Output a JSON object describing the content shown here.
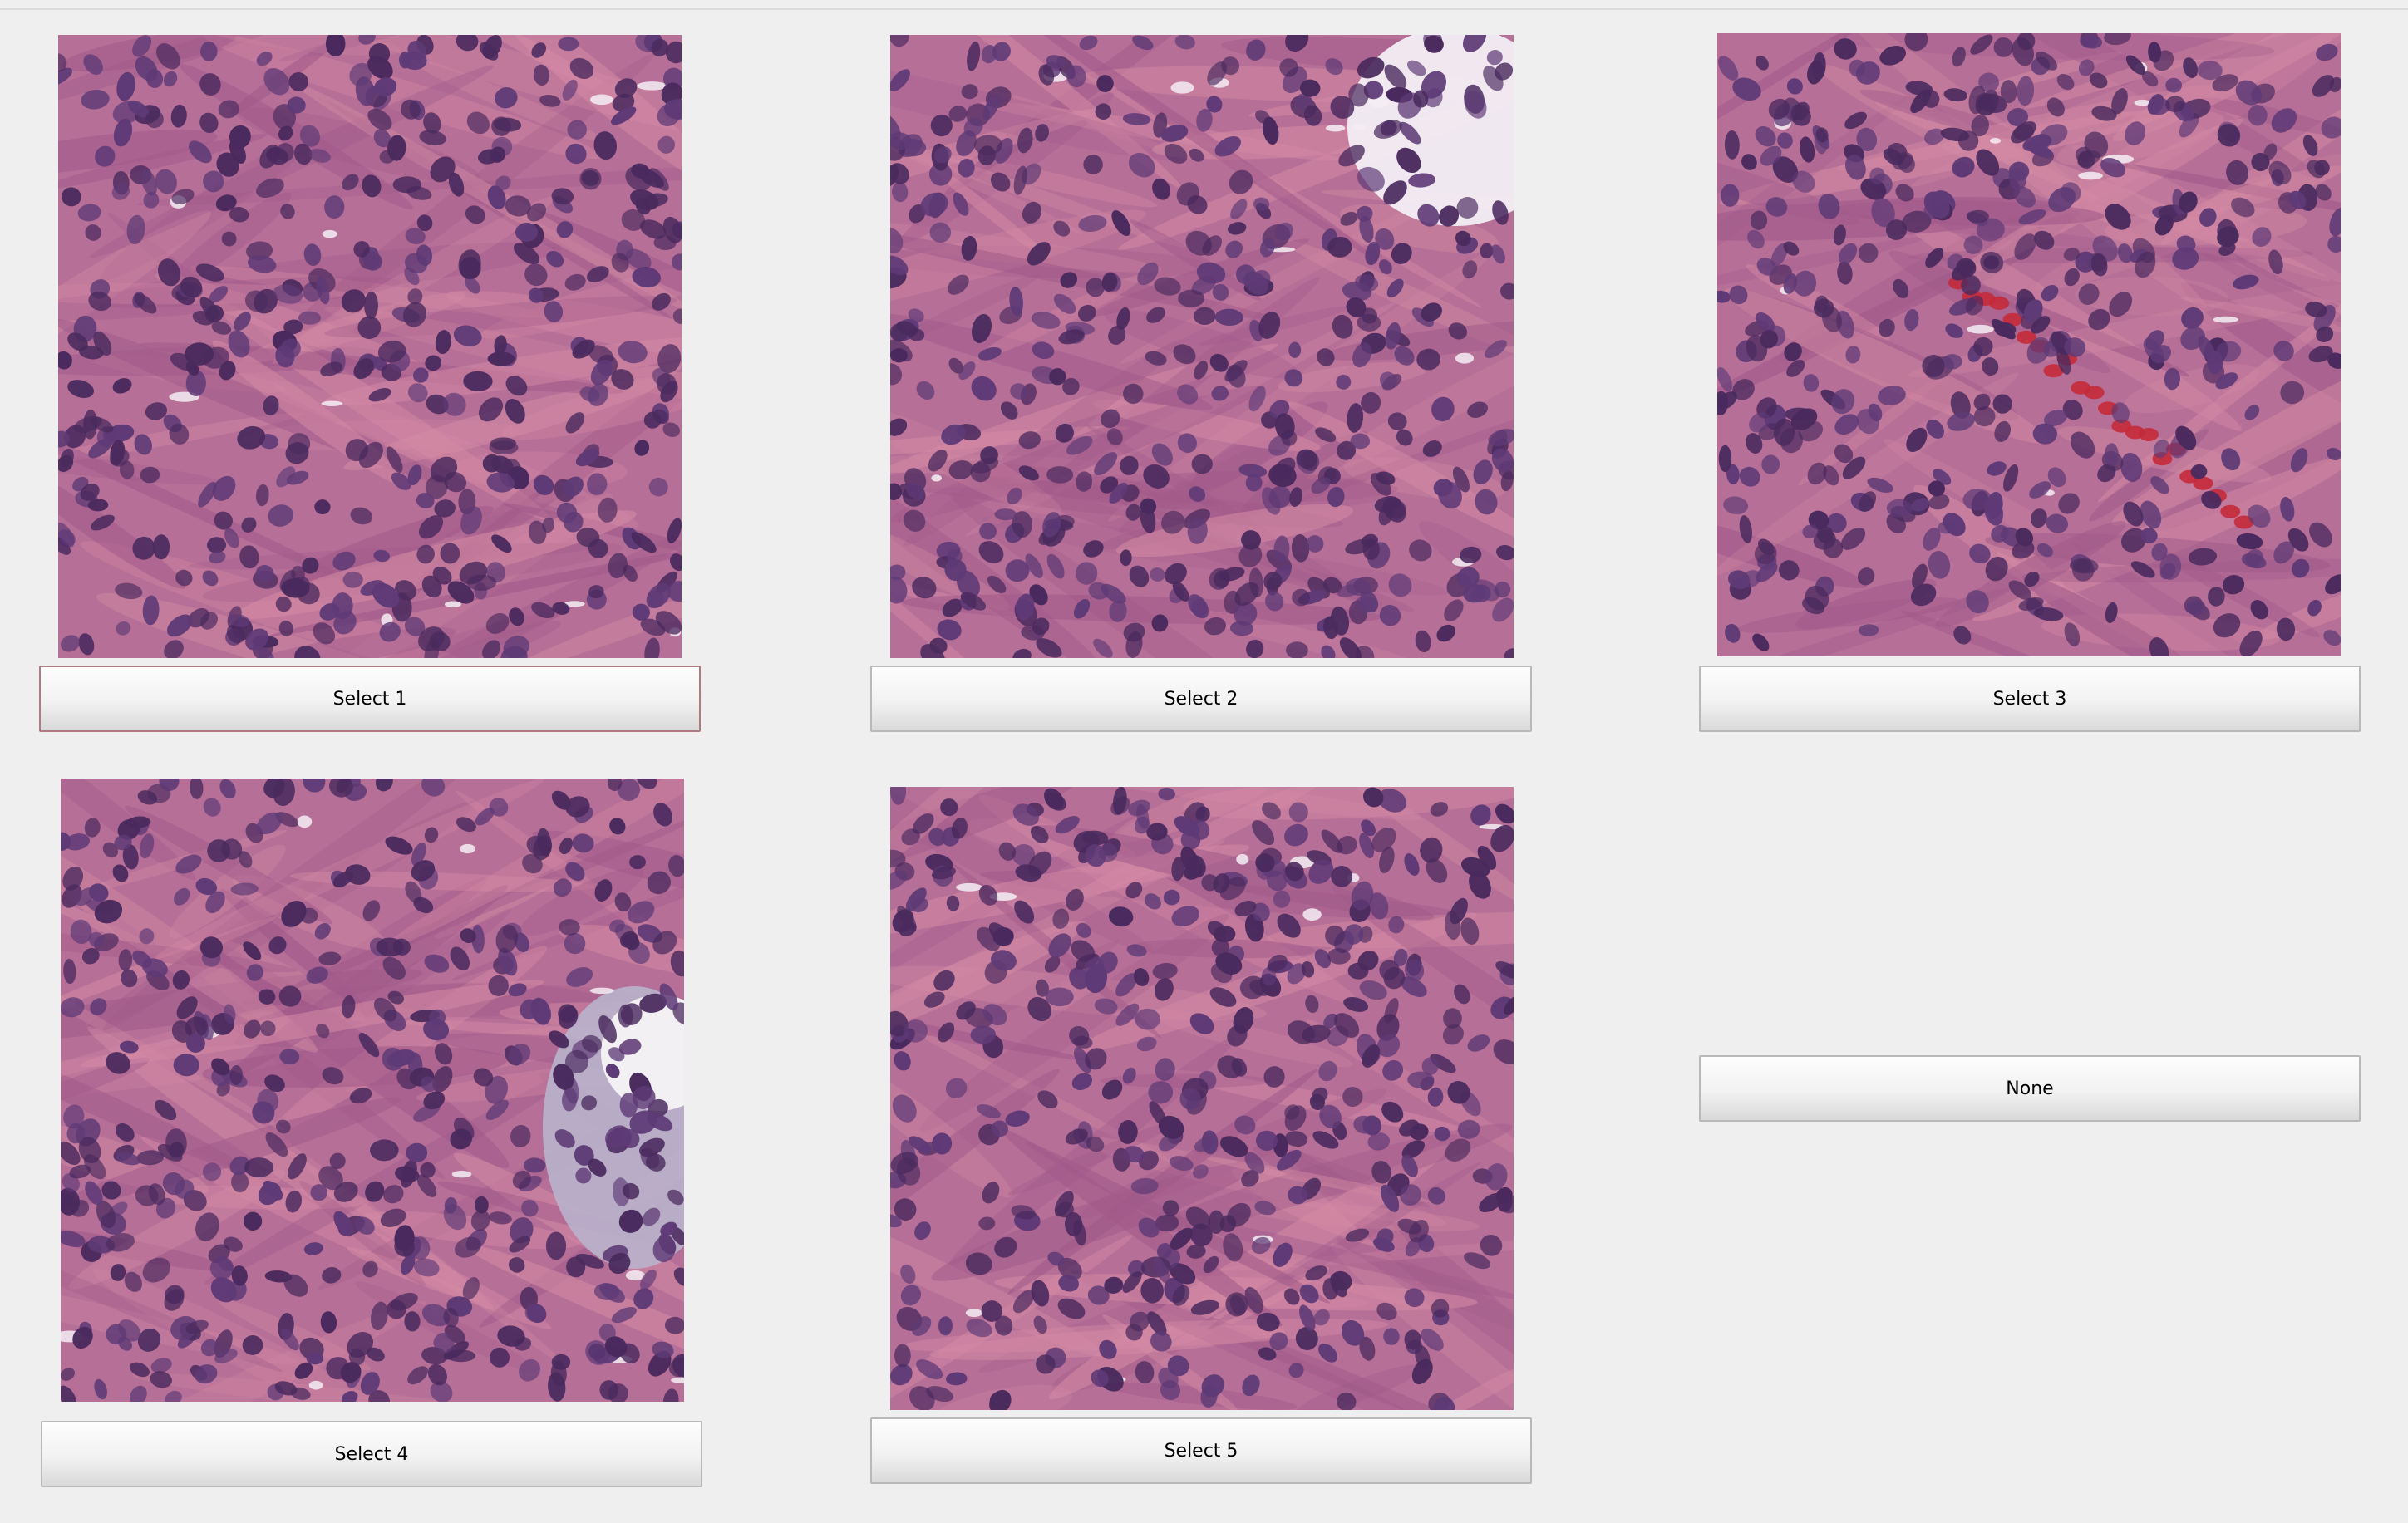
{
  "buttons": {
    "select_1": "Select 1",
    "select_2": "Select 2",
    "select_3": "Select 3",
    "select_4": "Select 4",
    "select_5": "Select 5",
    "none": "None"
  },
  "colors": {
    "background": "#efefef",
    "tissue_pink": "#c0708f",
    "nucleus_purple": "#4a2a5e",
    "focus_border": "#b07a80"
  }
}
